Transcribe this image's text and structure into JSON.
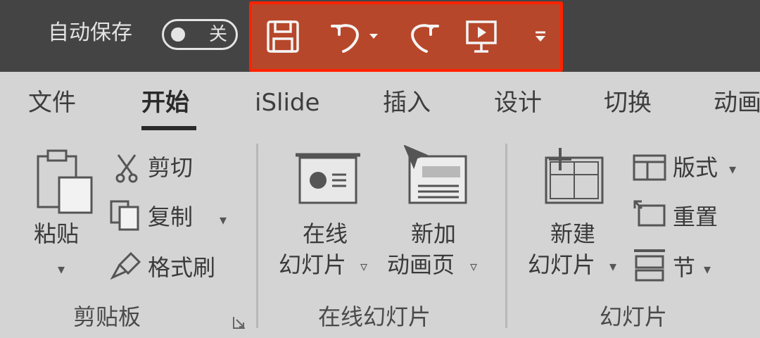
{
  "titlebar": {
    "autosave_label": "自动保存",
    "autosave_state": "关",
    "qat_buttons": [
      {
        "icon": "save-icon"
      },
      {
        "icon": "undo-icon"
      },
      {
        "icon": "redo-icon"
      },
      {
        "icon": "slideshow-icon"
      },
      {
        "icon": "customize-qat-icon"
      }
    ],
    "qat_highlight_color": "#b7472a",
    "qat_border_color": "#ff2200"
  },
  "ribbon": {
    "tabs": [
      {
        "label": "文件"
      },
      {
        "label": "开始"
      },
      {
        "label": "iSlide"
      },
      {
        "label": "插入"
      },
      {
        "label": "设计"
      },
      {
        "label": "切换"
      },
      {
        "label": "动画"
      }
    ],
    "active_tab": "开始",
    "clipboard": {
      "paste_label": "粘贴",
      "cut_label": "剪切",
      "copy_label": "复制",
      "format_painter_label": "格式刷",
      "group_label": "剪贴板"
    },
    "online_slides": {
      "online_slide_line1": "在线",
      "online_slide_line2": "幻灯片",
      "new_anim_line1": "新加",
      "new_anim_line2": "动画页",
      "group_label": "在线幻灯片"
    },
    "slides": {
      "new_slide_line1": "新建",
      "new_slide_line2": "幻灯片",
      "layout_label": "版式",
      "reset_label": "重置",
      "section_label": "节",
      "group_label": "幻灯片"
    }
  }
}
